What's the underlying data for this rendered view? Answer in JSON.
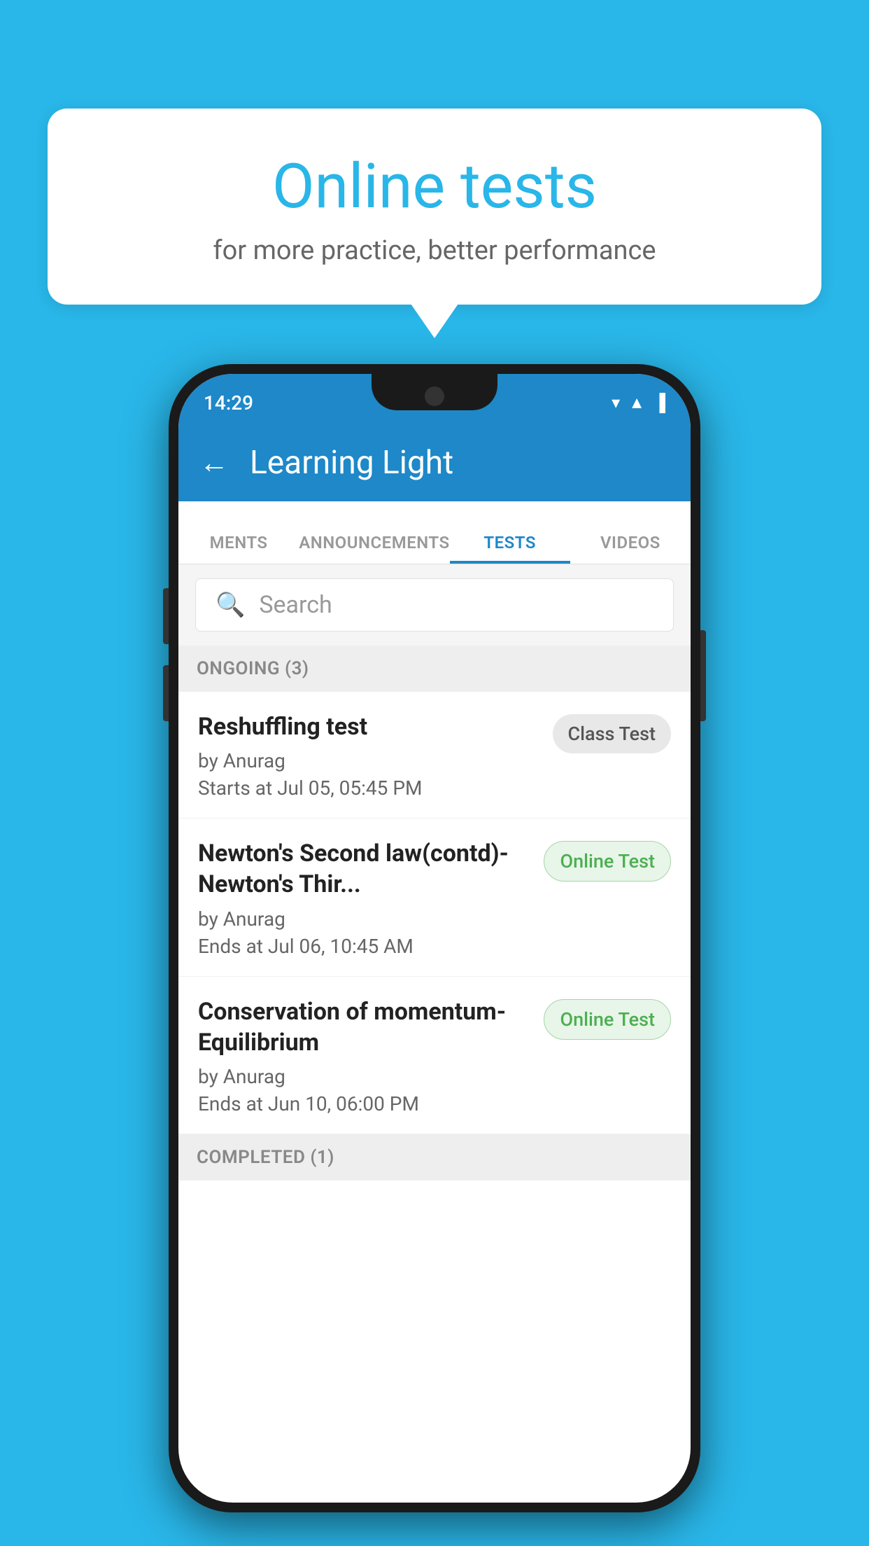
{
  "background_color": "#29b6e8",
  "speech_bubble": {
    "title": "Online tests",
    "subtitle": "for more practice, better performance"
  },
  "phone": {
    "status_bar": {
      "time": "14:29",
      "icons": "▾◂▐"
    },
    "app_bar": {
      "back_label": "←",
      "title": "Learning Light"
    },
    "tabs": [
      {
        "label": "MENTS",
        "active": false
      },
      {
        "label": "ANNOUNCEMENTS",
        "active": false
      },
      {
        "label": "TESTS",
        "active": true
      },
      {
        "label": "VIDEOS",
        "active": false
      }
    ],
    "search": {
      "placeholder": "Search",
      "icon": "🔍"
    },
    "ongoing_section": {
      "label": "ONGOING (3)"
    },
    "tests": [
      {
        "name": "Reshuffling test",
        "author": "by Anurag",
        "date": "Starts at  Jul 05, 05:45 PM",
        "badge": "Class Test",
        "badge_type": "class"
      },
      {
        "name": "Newton's Second law(contd)-Newton's Thir...",
        "author": "by Anurag",
        "date": "Ends at  Jul 06, 10:45 AM",
        "badge": "Online Test",
        "badge_type": "online"
      },
      {
        "name": "Conservation of momentum-Equilibrium",
        "author": "by Anurag",
        "date": "Ends at  Jun 10, 06:00 PM",
        "badge": "Online Test",
        "badge_type": "online"
      }
    ],
    "completed_section": {
      "label": "COMPLETED (1)"
    }
  }
}
